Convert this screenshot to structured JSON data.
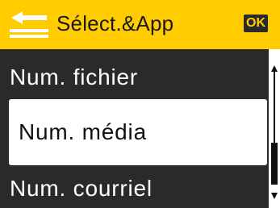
{
  "header": {
    "title": "Sélect.&App",
    "ok_label": "OK",
    "icon": "scanner-icon",
    "background": "#ffcc00"
  },
  "menu": {
    "items": [
      {
        "label": "Num. fichier",
        "selected": false
      },
      {
        "label": "Num. média",
        "selected": true
      },
      {
        "label": "Num. courriel",
        "selected": false
      }
    ],
    "background": "#2a2a2a",
    "selected_background": "#ffffff"
  },
  "scrollbar": {
    "up_icon": "scroll-up-arrow-icon",
    "down_icon": "scroll-down-arrow-icon"
  }
}
